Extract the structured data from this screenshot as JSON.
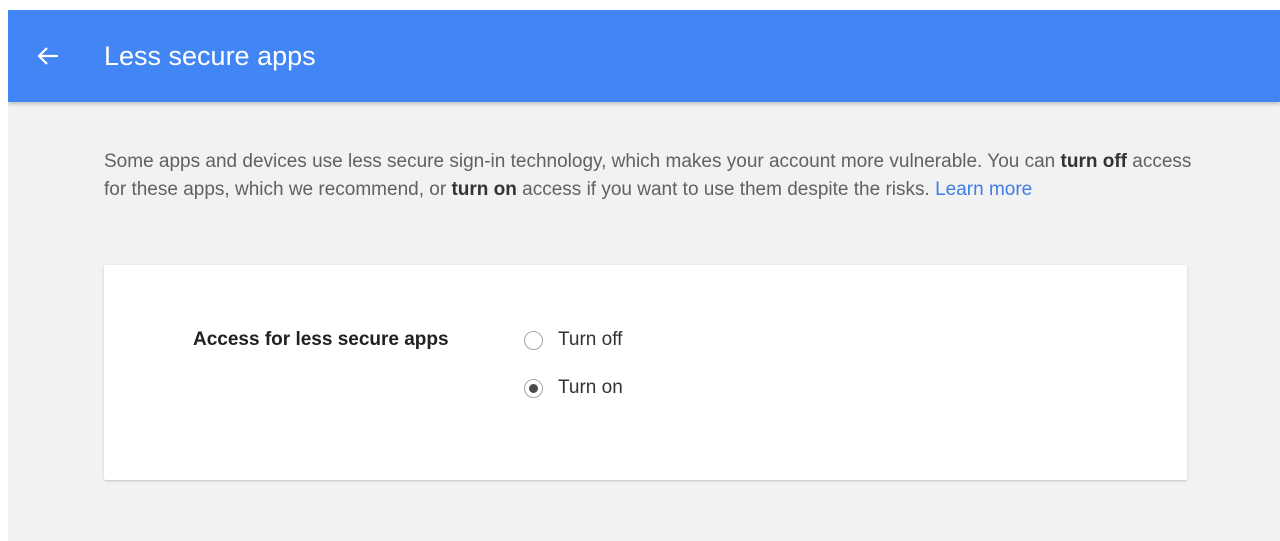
{
  "header": {
    "back_icon": "arrow-back-icon",
    "title": "Less secure apps"
  },
  "description": {
    "part1": "Some apps and devices use less secure sign-in technology, which makes your account more vulnerable. You can ",
    "bold1": "turn off",
    "part2": " access for these apps, which we recommend, or ",
    "bold2": "turn on",
    "part3": " access if you want to use them despite the risks. ",
    "link": "Learn more"
  },
  "setting": {
    "label": "Access for less secure apps",
    "options": [
      {
        "label": "Turn off",
        "selected": false
      },
      {
        "label": "Turn on",
        "selected": true
      }
    ]
  },
  "colors": {
    "appbar": "#4285f4",
    "link": "#3f7de6",
    "background": "#f2f2f2"
  }
}
